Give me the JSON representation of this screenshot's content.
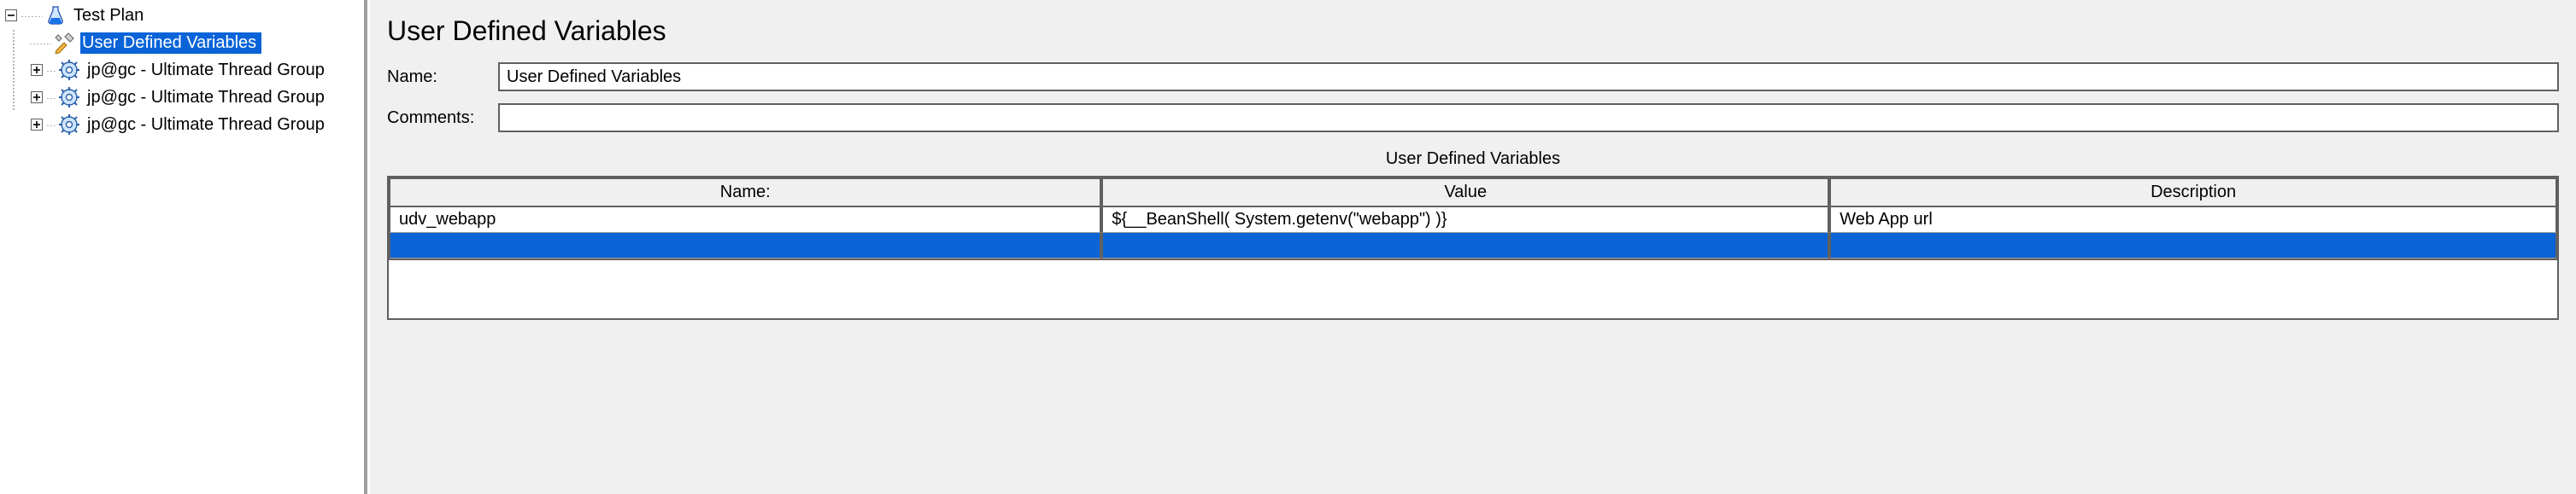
{
  "tree": {
    "root": {
      "label": "Test Plan"
    },
    "children": [
      {
        "label": "User Defined Variables",
        "selected": true,
        "icon": "wrench"
      },
      {
        "label": "jp@gc - Ultimate Thread Group",
        "expandable": true,
        "icon": "gear"
      },
      {
        "label": "jp@gc - Ultimate Thread Group",
        "expandable": true,
        "icon": "gear"
      },
      {
        "label": "jp@gc - Ultimate Thread Group",
        "expandable": true,
        "icon": "gear"
      }
    ]
  },
  "panel": {
    "title": "User Defined Variables",
    "name_label": "Name:",
    "name_value": "User Defined Variables",
    "comments_label": "Comments:",
    "comments_value": "",
    "table_caption": "User Defined Variables",
    "columns": {
      "name": "Name:",
      "value": "Value",
      "description": "Description"
    },
    "rows": [
      {
        "name": "udv_webapp",
        "value": "${__BeanShell( System.getenv(\"webapp\") )}",
        "description": "Web App url"
      }
    ]
  }
}
